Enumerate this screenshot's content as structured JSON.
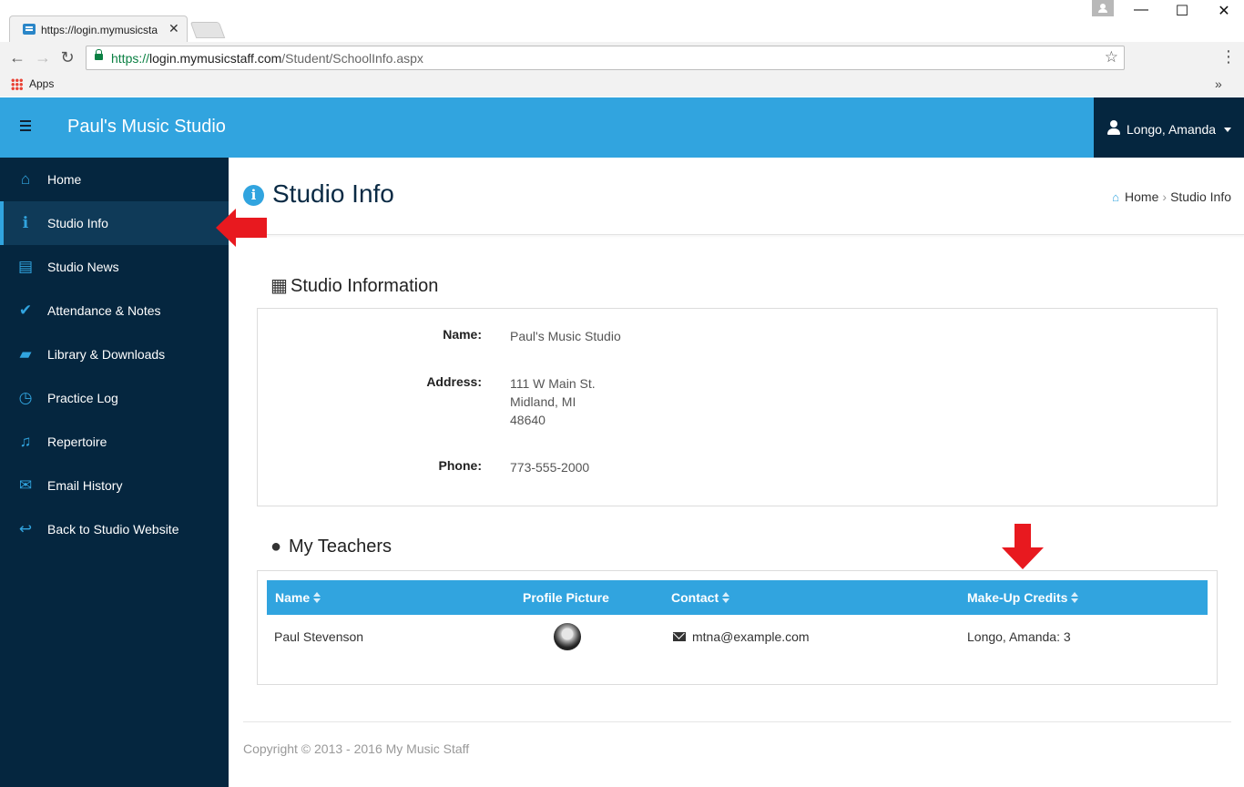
{
  "browser": {
    "tab_title": "https://login.mymusicsta",
    "tab_close": "✕",
    "url_scheme": "https://",
    "url_host": "login.mymusicstaff.com",
    "url_path": "/Student/SchoolInfo.aspx",
    "bookmarks_apps": "Apps",
    "bookmarks_more": "»",
    "window_controls": {
      "minimize": "—",
      "maximize": "☐",
      "close": "✕"
    }
  },
  "header": {
    "brand": "Paul's Music Studio",
    "user_name": "Longo, Amanda"
  },
  "sidebar": {
    "items": [
      {
        "label": "Home",
        "icon": "home-icon",
        "glyph": "⌂",
        "active": false
      },
      {
        "label": "Studio Info",
        "icon": "info-icon",
        "glyph": "ℹ",
        "active": true
      },
      {
        "label": "Studio News",
        "icon": "newspaper-icon",
        "glyph": "▤",
        "active": false
      },
      {
        "label": "Attendance & Notes",
        "icon": "check-icon",
        "glyph": "✔",
        "active": false
      },
      {
        "label": "Library & Downloads",
        "icon": "book-icon",
        "glyph": "▰",
        "active": false
      },
      {
        "label": "Practice Log",
        "icon": "clock-icon",
        "glyph": "◷",
        "active": false
      },
      {
        "label": "Repertoire",
        "icon": "music-note-icon",
        "glyph": "♫",
        "active": false
      },
      {
        "label": "Email History",
        "icon": "envelope-icon",
        "glyph": "✉",
        "active": false
      },
      {
        "label": "Back to Studio Website",
        "icon": "reply-icon",
        "glyph": "↩",
        "active": false
      }
    ]
  },
  "page": {
    "title": "Studio Info",
    "breadcrumb": {
      "home": "Home",
      "separator": "›",
      "current": "Studio Info"
    }
  },
  "studio_info": {
    "heading": "Studio Information",
    "name_label": "Name:",
    "name_value": "Paul's Music Studio",
    "address_label": "Address:",
    "address_lines": [
      "111 W Main St.",
      "Midland, MI",
      "48640"
    ],
    "phone_label": "Phone:",
    "phone_value": "773-555-2000"
  },
  "teachers": {
    "heading": "My Teachers",
    "columns": [
      "Name",
      "Profile Picture",
      "Contact",
      "Make-Up Credits"
    ],
    "rows": [
      {
        "name": "Paul Stevenson",
        "contact": "mtna@example.com",
        "makeup_credits": "Longo, Amanda: 3"
      }
    ]
  },
  "footer": {
    "copyright": "Copyright © 2013 - 2016 My Music Staff"
  },
  "colors": {
    "accent": "#31a4df",
    "sidebar": "#05263f",
    "annotation": "#e8191f"
  }
}
